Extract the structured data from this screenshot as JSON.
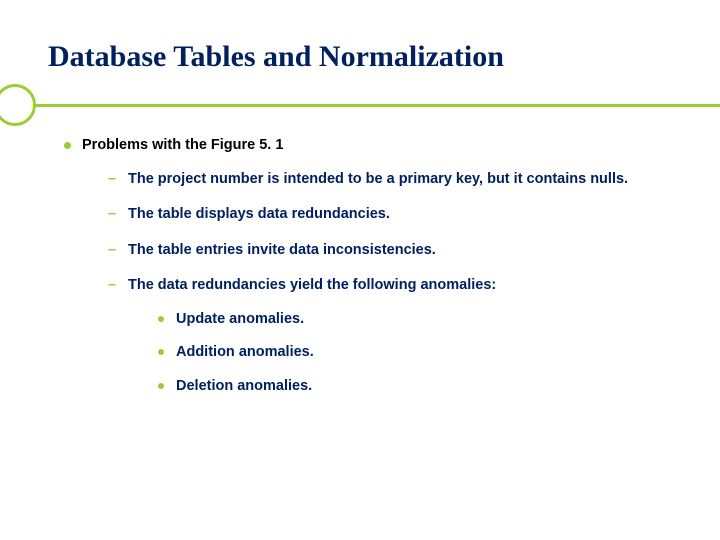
{
  "title": "Database Tables and Normalization",
  "bullets": {
    "l1": "Problems with the Figure 5. 1",
    "l2": [
      "The project number is intended to be a primary key, but it contains nulls.",
      "The table displays data redundancies.",
      "The table entries invite data inconsistencies.",
      "The data redundancies yield the following  anomalies:"
    ],
    "l3": [
      "Update anomalies.",
      "Addition anomalies.",
      "Deletion anomalies."
    ]
  }
}
